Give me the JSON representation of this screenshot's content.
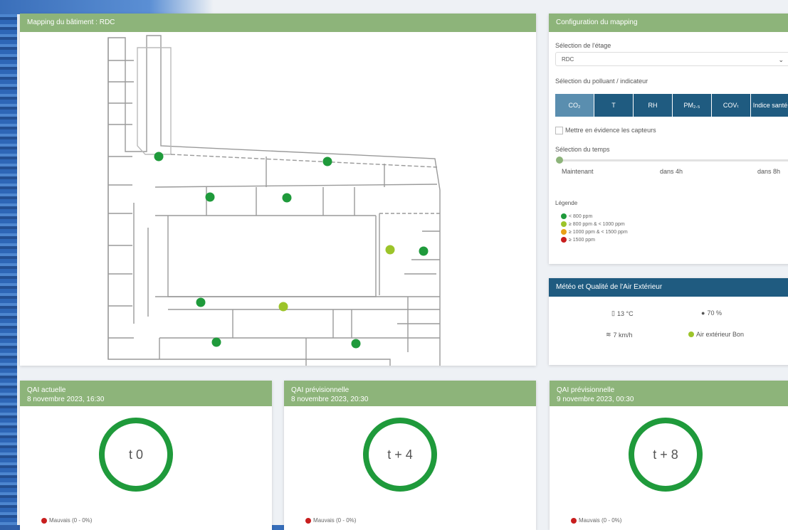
{
  "map": {
    "title": "Mapping du bâtiment : RDC",
    "sensors": [
      {
        "status": "good"
      },
      {
        "status": "good"
      },
      {
        "status": "good"
      },
      {
        "status": "good"
      },
      {
        "status": "moderate"
      },
      {
        "status": "good"
      },
      {
        "status": "good"
      },
      {
        "status": "moderate"
      },
      {
        "status": "good"
      },
      {
        "status": "good"
      }
    ]
  },
  "config": {
    "title": "Configuration du mapping",
    "floor_label": "Sélection de l'étage",
    "floor_value": "RDC",
    "pollutant_label": "Sélection du polluant / indicateur",
    "pollutants": [
      {
        "label": "CO₂",
        "active": true
      },
      {
        "label": "T",
        "active": false
      },
      {
        "label": "RH",
        "active": false
      },
      {
        "label": "PM₂.₅",
        "active": false
      },
      {
        "label": "COVₜ",
        "active": false
      },
      {
        "label": "Indice santé",
        "active": false
      }
    ],
    "highlight_label": "Mettre en évidence les capteurs",
    "time_label": "Sélection du temps",
    "time_ticks": [
      "Maintenant",
      "dans 4h",
      "dans 8h"
    ],
    "legend_title": "Légende",
    "legend": [
      {
        "label": "< 800 ppm",
        "color": "#1f9a3b"
      },
      {
        "label": "≥ 800 ppm & < 1000 ppm",
        "color": "#9cc42a"
      },
      {
        "label": "≥ 1000 ppm & < 1500 ppm",
        "color": "#e8a017"
      },
      {
        "label": "≥ 1500 ppm",
        "color": "#c81e1e"
      }
    ]
  },
  "weather": {
    "title": "Météo et Qualité de l'Air Extérieur",
    "temperature": "13 °C",
    "humidity": "70 %",
    "wind": "7 km/h",
    "air_quality": "Air extérieur Bon",
    "air_color": "#9cc42a"
  },
  "qai": [
    {
      "title": "QAI actuelle",
      "date": "8 novembre 2023, 16:30",
      "ring": "t 0",
      "legend": "Mauvais (0 - 0%)"
    },
    {
      "title": "QAI prévisionnelle",
      "date": "8 novembre 2023, 20:30",
      "ring": "t + 4",
      "legend": "Mauvais (0 - 0%)"
    },
    {
      "title": "QAI prévisionnelle",
      "date": "9 novembre 2023, 00:30",
      "ring": "t + 8",
      "legend": "Mauvais (0 - 0%)"
    }
  ],
  "colors": {
    "good": "#1f9a3b",
    "moderate": "#9cc42a",
    "bad": "#c81e1e",
    "header_green": "#8db47a",
    "header_blue": "#1f5b80"
  }
}
